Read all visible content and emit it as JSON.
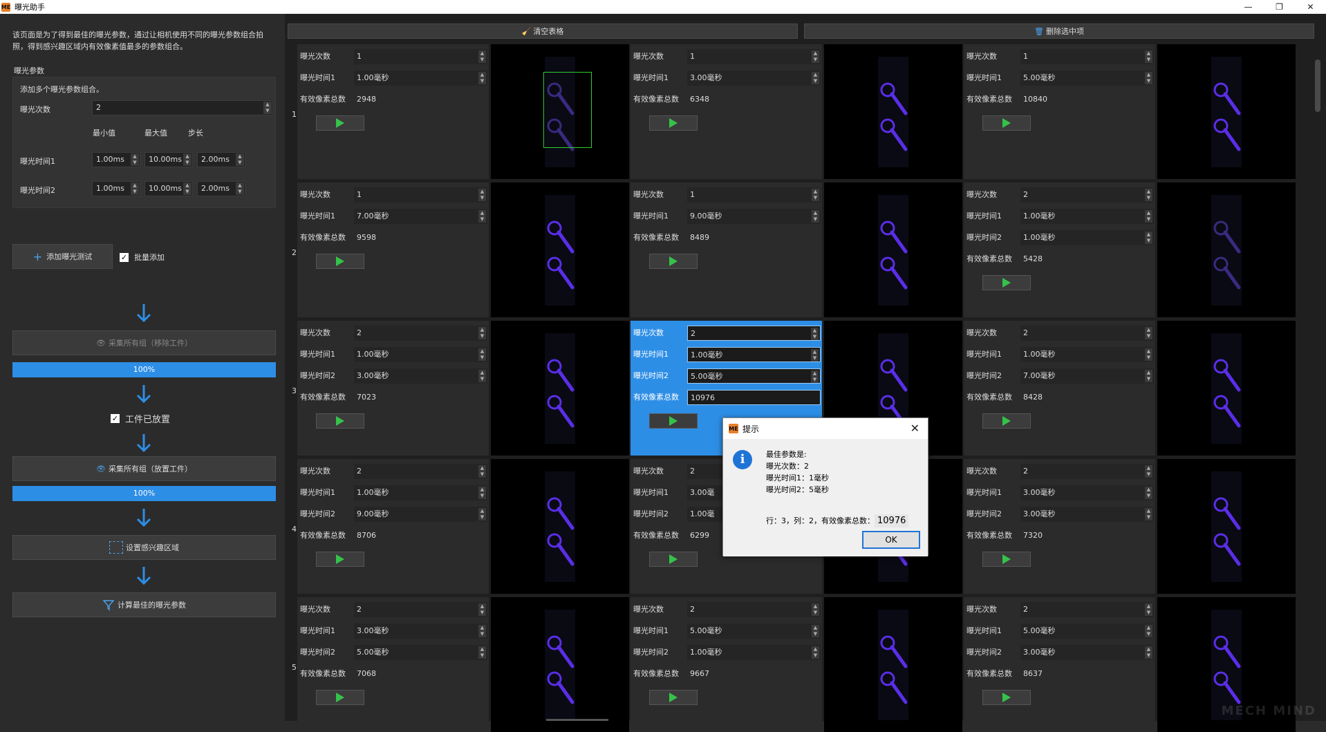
{
  "window": {
    "logo": "ME",
    "title": "曝光助手",
    "minimize": "—",
    "maximize": "❐",
    "close": "✕"
  },
  "left": {
    "intro": "该页面是为了得到最佳的曝光参数，通过让相机使用不同的曝光参数组合拍照，得到感兴趣区域内有效像素值最多的参数组合。",
    "section_title": "曝光参数",
    "group": {
      "hint": "添加多个曝光参数组合。",
      "count_label": "曝光次数",
      "count_value": "2",
      "col_min": "最小值",
      "col_max": "最大值",
      "col_step": "步长",
      "rows": [
        {
          "label": "曝光时间1",
          "min": "1.00ms",
          "max": "10.00ms",
          "step": "2.00ms"
        },
        {
          "label": "曝光时间2",
          "min": "1.00ms",
          "max": "10.00ms",
          "step": "2.00ms"
        }
      ]
    },
    "add_button": "添加曝光测试",
    "batch_add": "批量添加",
    "capture_remove": "采集所有组（移除工件）",
    "progress1": "100%",
    "workpiece_placed": "工件已放置",
    "capture_place": "采集所有组（放置工件）",
    "progress2": "100%",
    "set_roi": "设置感兴趣区域",
    "calculate": "计算最佳的曝光参数"
  },
  "toolbar": {
    "clear": "清空表格",
    "delete": "删除选中项"
  },
  "labels": {
    "count": "曝光次数",
    "time1": "曝光时间1",
    "time2": "曝光时间2",
    "pixels": "有效像素总数"
  },
  "grid": [
    {
      "row": "1",
      "cells": [
        {
          "count": "1",
          "time1": "1.00毫秒",
          "pixels": "2948"
        },
        {
          "count": "1",
          "time1": "3.00毫秒",
          "pixels": "6348"
        },
        {
          "count": "1",
          "time1": "5.00毫秒",
          "pixels": "10840"
        }
      ]
    },
    {
      "row": "2",
      "cells": [
        {
          "count": "1",
          "time1": "7.00毫秒",
          "pixels": "9598"
        },
        {
          "count": "1",
          "time1": "9.00毫秒",
          "pixels": "8489"
        },
        {
          "count": "2",
          "time1": "1.00毫秒",
          "time2": "1.00毫秒",
          "pixels": "5428"
        }
      ]
    },
    {
      "row": "3",
      "cells": [
        {
          "count": "2",
          "time1": "1.00毫秒",
          "time2": "3.00毫秒",
          "pixels": "7023"
        },
        {
          "count": "2",
          "time1": "1.00毫秒",
          "time2": "5.00毫秒",
          "pixels": "10976",
          "selected": true
        },
        {
          "count": "2",
          "time1": "1.00毫秒",
          "time2": "7.00毫秒",
          "pixels": "8428"
        }
      ]
    },
    {
      "row": "4",
      "cells": [
        {
          "count": "2",
          "time1": "1.00毫秒",
          "time2": "9.00毫秒",
          "pixels": "8706"
        },
        {
          "count": "2",
          "time1": "3.00毫",
          "time2": "1.00毫",
          "pixels": "6299"
        },
        {
          "count": "2",
          "time1": "3.00毫秒",
          "time2": "3.00毫秒",
          "pixels": "7320"
        }
      ]
    },
    {
      "row": "5",
      "cells": [
        {
          "count": "2",
          "time1": "3.00毫秒",
          "time2": "5.00毫秒",
          "pixels": "7068"
        },
        {
          "count": "2",
          "time1": "5.00毫秒",
          "time2": "1.00毫秒",
          "pixels": "9667"
        },
        {
          "count": "2",
          "time1": "5.00毫秒",
          "time2": "3.00毫秒",
          "pixels": "8637"
        }
      ]
    }
  ],
  "dialog": {
    "logo": "ME",
    "title": "提示",
    "close": "✕",
    "info": "i",
    "message": "最佳参数是:\n曝光次数：2\n曝光时间1：1毫秒\n曝光时间2：5毫秒",
    "result_prefix": "行：3，列：2，有效像素总数：",
    "result_value": "10976",
    "ok": "OK"
  },
  "watermark": "MECH MIND",
  "colors": {
    "accent": "#2d8ee6",
    "play": "#35c24a",
    "part": "#5a2ee8",
    "roi": "#2ed12e"
  }
}
